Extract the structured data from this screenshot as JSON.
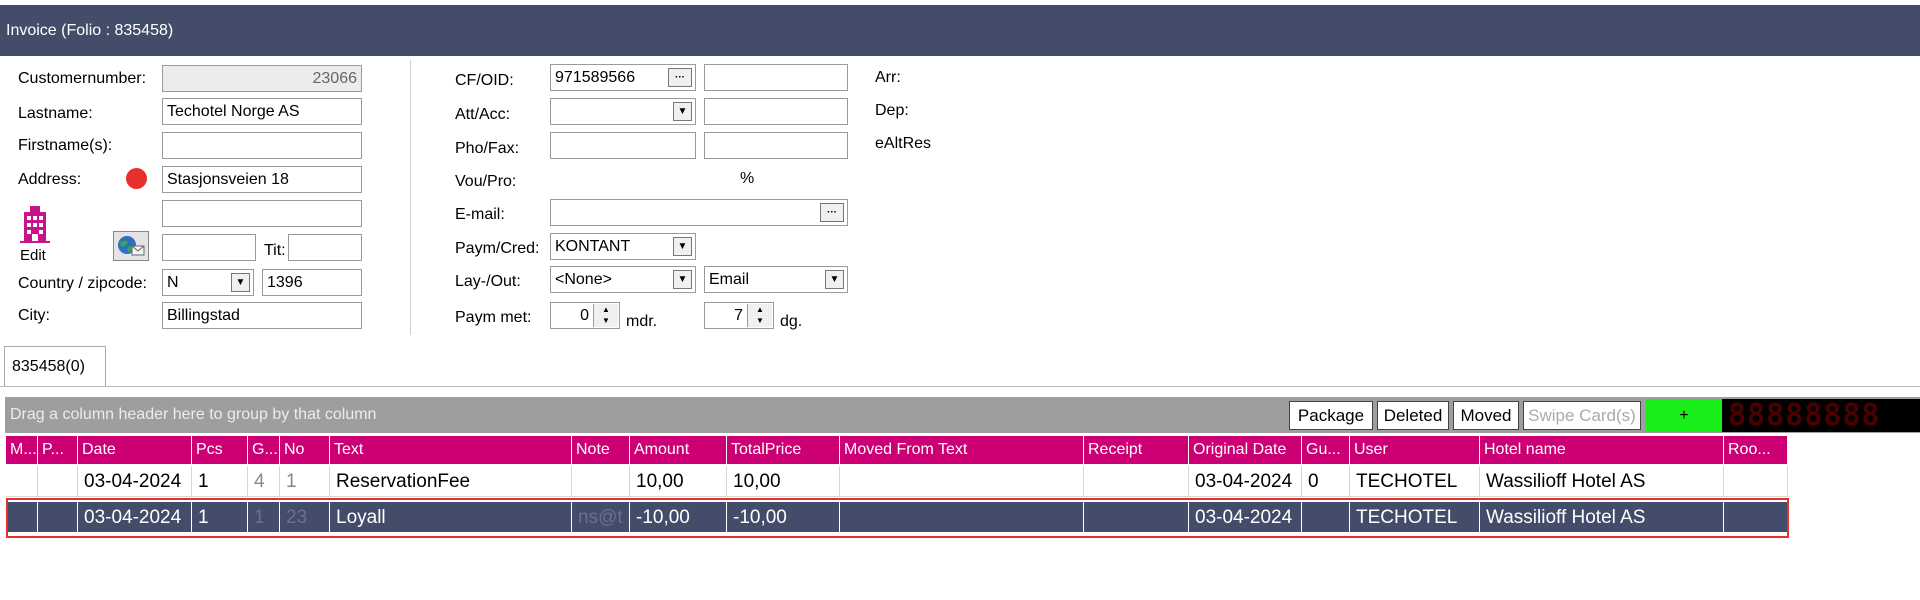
{
  "window": {
    "title": "Invoice (Folio : 835458)"
  },
  "customer": {
    "customernumber_label": "Customernumber:",
    "customernumber": "23066",
    "lastname_label": "Lastname:",
    "lastname": "Techotel Norge AS",
    "firstname_label": "Firstname(s):",
    "firstname": "",
    "address_label": "Address:",
    "address1": "Stasjonsveien 18",
    "address2": "",
    "address3": "",
    "edit_label": "Edit",
    "tit_label": "Tit:",
    "tit": "",
    "country_label": "Country / zipcode:",
    "country": "N",
    "zipcode": "1396",
    "city_label": "City:",
    "city": "Billingstad"
  },
  "contact": {
    "cfoid_label": "CF/OID:",
    "cfoid": "971589566",
    "cfoid_btn": "···",
    "cfoid_extra": "",
    "attacc_label": "Att/Acc:",
    "attacc": "",
    "attacc_extra": "",
    "phofax_label": "Pho/Fax:",
    "phone": "",
    "fax": "",
    "voupro_label": "Vou/Pro:",
    "percent": "%",
    "email_label": "E-mail:",
    "email": "",
    "email_btn": "···",
    "paymcred_label": "Paym/Cred:",
    "paymcred": "KONTANT",
    "layout_label": "Lay-/Out:",
    "layout": "<None>",
    "output": "Email",
    "paymmet_label": "Paym met:",
    "months": "0",
    "months_unit": "mdr.",
    "days": "7",
    "days_unit": "dg."
  },
  "dates": {
    "arr_label": "Arr:",
    "dep_label": "Dep:",
    "ealtres_label": "eAltRes"
  },
  "tabs": [
    {
      "label": "835458(0)"
    }
  ],
  "grid": {
    "group_hint": "Drag a column header here to group by that column",
    "buttons": {
      "package": "Package",
      "deleted": "Deleted",
      "moved": "Moved",
      "swipe": "Swipe Card(s)",
      "plus": "+"
    },
    "led": "88888888",
    "columns": [
      "M...",
      "P...",
      "Date",
      "Pcs",
      "G...",
      "No",
      "Text",
      "Note",
      "Amount",
      "TotalPrice",
      "Moved From Text",
      "Receipt",
      "Original Date",
      "Gu...",
      "User",
      "Hotel name",
      "Roo..."
    ],
    "rows": [
      {
        "m": "",
        "p": "",
        "date": "03-04-2024",
        "pcs": "1",
        "g": "4",
        "no": "1",
        "text": "ReservationFee",
        "note": "",
        "amount": "10,00",
        "total": "10,00",
        "moved_from": "",
        "receipt": "",
        "orig_date": "03-04-2024",
        "gu": "0",
        "user": "TECHOTEL",
        "hotel": "Wassilioff Hotel AS",
        "room": ""
      },
      {
        "m": "",
        "p": "",
        "date": "03-04-2024",
        "pcs": "1",
        "g": "1",
        "no": "23",
        "text": "Loyall",
        "note": "ns@t",
        "amount": "-10,00",
        "total": "-10,00",
        "moved_from": "",
        "receipt": "",
        "orig_date": "03-04-2024",
        "gu": "",
        "user": "TECHOTEL",
        "hotel": "Wassilioff Hotel AS",
        "room": ""
      }
    ]
  },
  "colors": {
    "titlebar": "#434c69",
    "header": "#cc0074",
    "selected_row": "#434c69",
    "plus_button": "#18ee18",
    "red_dot": "#e8302a"
  }
}
